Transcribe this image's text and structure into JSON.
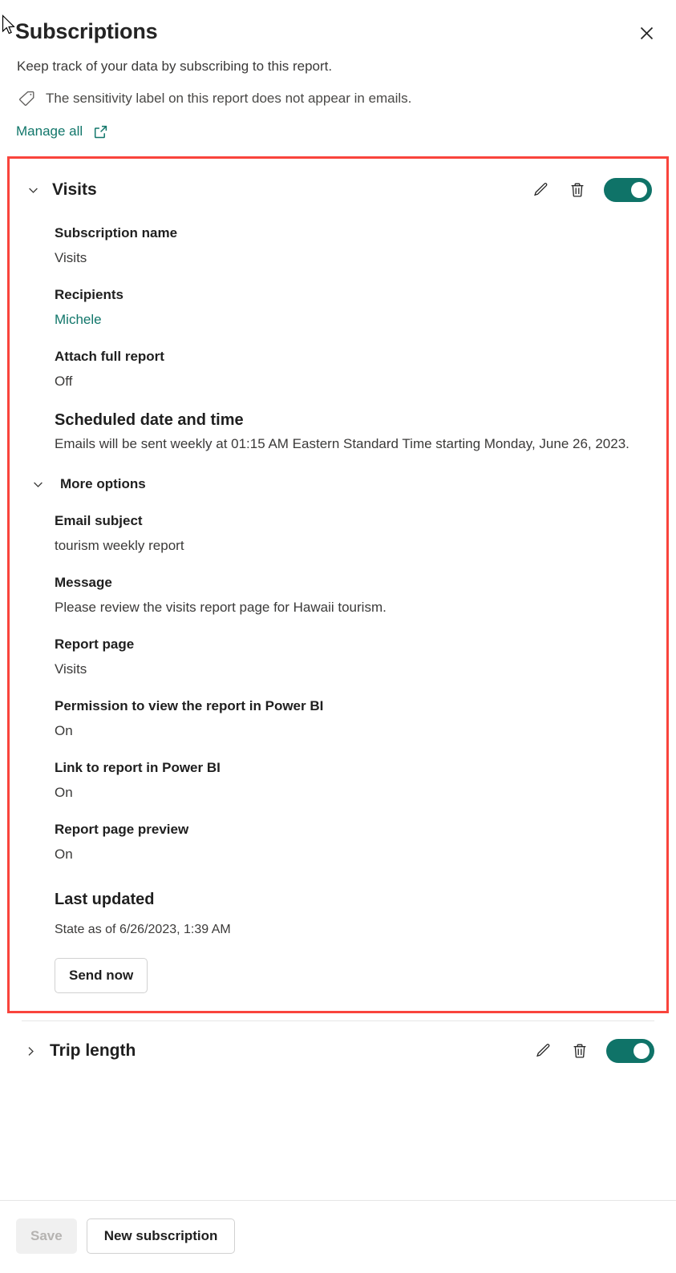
{
  "header": {
    "title": "Subscriptions",
    "close_icon": "close-icon",
    "subtitle": "Keep track of your data by subscribing to this report.",
    "sensitivity_icon": "tag-icon",
    "sensitivity_text": "The sensitivity label on this report does not appear in emails.",
    "manage_all_label": "Manage all",
    "manage_all_icon": "external-link-icon"
  },
  "colors": {
    "accent_teal": "#11766a",
    "toggle_on": "#0f7368",
    "highlight_red": "#f9443c",
    "text_primary": "#1f1f1f",
    "text_secondary": "#3b3a39"
  },
  "subscriptions": [
    {
      "name": "Visits",
      "expanded": true,
      "chevron_icon": "chevron-down-icon",
      "edit_icon": "pencil-icon",
      "delete_icon": "trash-icon",
      "toggle_state": "On",
      "fields": {
        "subscription_name_label": "Subscription name",
        "subscription_name_value": "Visits",
        "recipients_label": "Recipients",
        "recipients_value": "Michele",
        "attach_full_report_label": "Attach full report",
        "attach_full_report_value": "Off",
        "scheduled_label": "Scheduled date and time",
        "scheduled_value": "Emails will be sent weekly at 01:15 AM Eastern Standard Time starting Monday, June 26, 2023.",
        "more_options_label": "More options",
        "more_options_icon": "chevron-down-icon",
        "email_subject_label": "Email subject",
        "email_subject_value": "tourism weekly report",
        "message_label": "Message",
        "message_value": "Please review the visits report page for Hawaii tourism.",
        "report_page_label": "Report page",
        "report_page_value": "Visits",
        "permission_label": "Permission to view the report in Power BI",
        "permission_value": "On",
        "link_label": "Link to report in Power BI",
        "link_value": "On",
        "preview_label": "Report page preview",
        "preview_value": "On",
        "last_updated_label": "Last updated",
        "last_updated_value": "State as of 6/26/2023, 1:39 AM",
        "send_now_label": "Send now"
      }
    },
    {
      "name": "Trip length",
      "expanded": false,
      "chevron_icon": "chevron-right-icon",
      "edit_icon": "pencil-icon",
      "delete_icon": "trash-icon",
      "toggle_state": "On"
    }
  ],
  "footer": {
    "save_label": "Save",
    "save_disabled": true,
    "new_subscription_label": "New subscription"
  }
}
